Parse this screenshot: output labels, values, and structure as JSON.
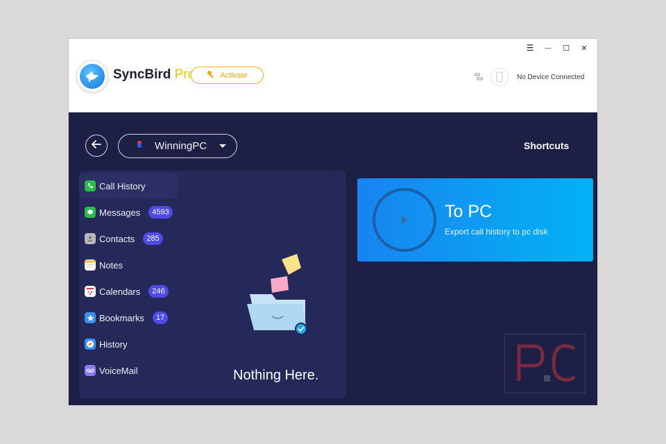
{
  "window_controls": {
    "menu": "☰",
    "minimize": "—",
    "maximize": "☐",
    "close": "✕"
  },
  "header": {
    "app_name": "SyncBird",
    "app_suffix": "Pro",
    "activate_label": "Activate",
    "device_status": "No Device Connected"
  },
  "toolbar": {
    "device_name": "WinningPC",
    "shortcuts_label": "Shortcuts"
  },
  "sidebar": {
    "items": [
      {
        "label": "Call History",
        "badge": "",
        "icon": "phone-icon",
        "icon_color": "#2bbd4a"
      },
      {
        "label": "Messages",
        "badge": "4593",
        "icon": "message-bubble-icon",
        "icon_color": "#2bbd4a"
      },
      {
        "label": "Contacts",
        "badge": "285",
        "icon": "contacts-book-icon",
        "icon_color": "#b8b8b8"
      },
      {
        "label": "Notes",
        "badge": "",
        "icon": "notes-icon",
        "icon_color": "#f6c64a"
      },
      {
        "label": "Calendars",
        "badge": "246",
        "icon": "calendar-icon",
        "icon_color": "#ffffff"
      },
      {
        "label": "Bookmarks",
        "badge": "17",
        "icon": "star-icon",
        "icon_color": "#3b8df0"
      },
      {
        "label": "History",
        "badge": "",
        "icon": "compass-icon",
        "icon_color": "#3b8df0"
      },
      {
        "label": "VoiceMail",
        "badge": "",
        "icon": "voicemail-icon",
        "icon_color": "#8a7bf0"
      }
    ]
  },
  "empty_state": {
    "text": "Nothing Here."
  },
  "action_card": {
    "title": "To PC",
    "subtitle": "Export call history to pc disk"
  },
  "watermark": {
    "text": "P.C"
  },
  "colors": {
    "window_bg": "#1d1f44",
    "panel_bg": "#25295a",
    "badge_bg": "#4e4be8",
    "accent_yellow": "#f3c400",
    "card_gradient_start": "#1784f0",
    "card_gradient_end": "#02b2f5"
  }
}
